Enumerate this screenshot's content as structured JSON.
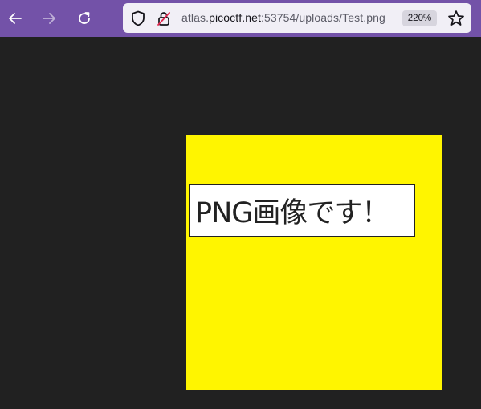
{
  "toolbar": {
    "back_icon": "back-arrow-icon",
    "forward_icon": "forward-arrow-icon",
    "reload_icon": "reload-icon"
  },
  "urlbar": {
    "url_prefix": "atlas.",
    "url_host": "picoctf.net",
    "url_suffix": ":53754/uploads/Test.png",
    "zoom_level": "220%",
    "shield_icon": "tracking-protection-shield-icon",
    "lock_icon": "insecure-lock-icon",
    "bookmark_icon": "bookmark-star-icon"
  },
  "content": {
    "image_text": "PNG画像です！",
    "image_background": "#fff500"
  },
  "colors": {
    "toolbar": "#7352a8",
    "page_background": "#212121"
  }
}
